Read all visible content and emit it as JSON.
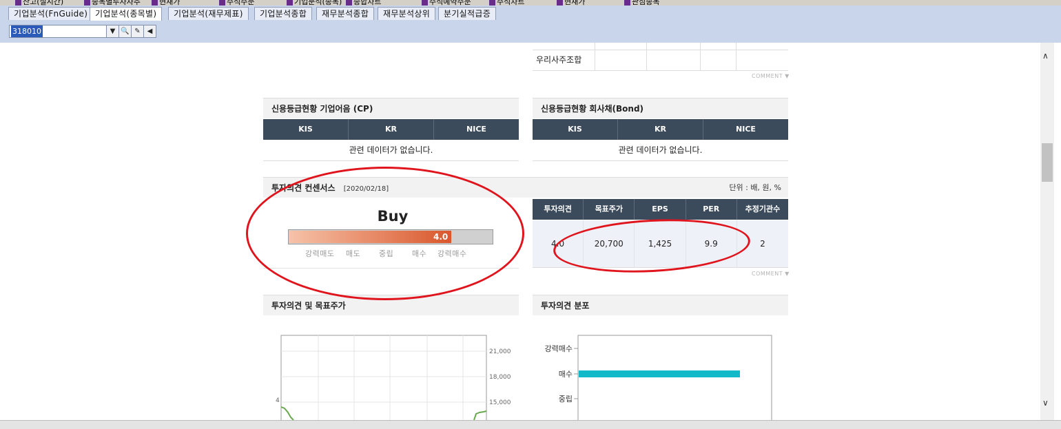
{
  "window_tabs_clipped": [
    "잔고(실시간)",
    "종목별투자자추",
    "현재가",
    "주식주문",
    "기업분석(종목)",
    "종합차트",
    "주식예약주문",
    "주식차트",
    "현재가",
    "관심종목"
  ],
  "tabs": [
    {
      "label": "기업분석(FnGuide)",
      "active": false
    },
    {
      "label": "기업분석(종목별)",
      "active": true
    },
    {
      "label": "기업분석(재무제표)",
      "active": false
    },
    {
      "label": "기업분석종합",
      "active": false
    },
    {
      "label": "재무분석종합",
      "active": false
    },
    {
      "label": "재무분석상위",
      "active": false
    },
    {
      "label": "분기실적급증",
      "active": false
    }
  ],
  "code_input": {
    "value": "318010"
  },
  "toolbar_icons": [
    "chevron-down-icon",
    "search-icon",
    "tools-icon",
    "megaphone-icon"
  ],
  "shareholder_table": {
    "row_label": "우리사주조합"
  },
  "comment_label": "COMMENT",
  "credit_cp": {
    "title": "신용등급현황 기업어음 (CP)",
    "columns": [
      "KIS",
      "KR",
      "NICE"
    ],
    "empty_message": "관련 데이터가 없습니다."
  },
  "credit_bond": {
    "title": "신용등급현황 회사채(Bond)",
    "columns": [
      "KIS",
      "KR",
      "NICE"
    ],
    "empty_message": "관련 데이터가 없습니다."
  },
  "consensus": {
    "title": "투자의견 컨센서스",
    "date": "[2020/02/18]",
    "unit": "단위 : 배, 원, %",
    "opinion_text": "Buy",
    "opinion_score": "4.0",
    "score_fraction": 0.8,
    "scale_labels": [
      "강력매도",
      "매도",
      "중립",
      "매수",
      "강력매수"
    ],
    "table": {
      "headers": [
        "투자의견",
        "목표주가",
        "EPS",
        "PER",
        "추정기관수"
      ],
      "values": [
        "4.0",
        "20,700",
        "1,425",
        "9.9",
        "2"
      ]
    }
  },
  "chart_left": {
    "title": "투자의견 및 목표주가",
    "chart_data": {
      "type": "line",
      "left_tick_labels": [
        "4"
      ],
      "right_tick_labels": [
        "21,000",
        "18,000",
        "15,000"
      ]
    }
  },
  "chart_right": {
    "title": "투자의견 분포",
    "chart_data": {
      "type": "bar",
      "orientation": "horizontal",
      "categories": [
        "강력매수",
        "매수",
        "중립"
      ],
      "values": [
        0,
        1,
        0
      ],
      "color": "#12b9c8"
    }
  },
  "annotation_color": "#e0141c"
}
